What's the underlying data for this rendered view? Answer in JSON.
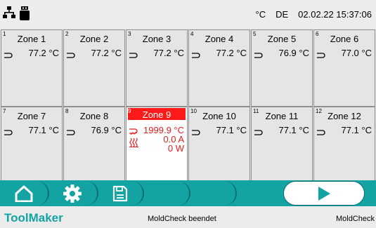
{
  "topbar": {
    "unit": "°C",
    "language": "DE",
    "date": "02.02.22",
    "time": "15:37:06"
  },
  "zones": [
    {
      "num": "1",
      "title": "Zone 1",
      "temp": "77.2 °C"
    },
    {
      "num": "2",
      "title": "Zone 2",
      "temp": "77.2 °C"
    },
    {
      "num": "3",
      "title": "Zone 3",
      "temp": "77.2 °C"
    },
    {
      "num": "4",
      "title": "Zone 4",
      "temp": "77.2 °C"
    },
    {
      "num": "5",
      "title": "Zone 5",
      "temp": "76.9 °C"
    },
    {
      "num": "6",
      "title": "Zone 6",
      "temp": "77.0 °C"
    },
    {
      "num": "7",
      "title": "Zone 7",
      "temp": "77.1 °C"
    },
    {
      "num": "8",
      "title": "Zone 8",
      "temp": "76.9 °C"
    },
    {
      "num": "9",
      "title": "Zone 9",
      "temp": "1999.9 °C",
      "current": "0.0 A",
      "power": "0 W",
      "alarm": true
    },
    {
      "num": "10",
      "title": "Zone 10",
      "temp": "77.1 °C"
    },
    {
      "num": "11",
      "title": "Zone 11",
      "temp": "77.1 °C"
    },
    {
      "num": "12",
      "title": "Zone 12",
      "temp": "77.1 °C"
    }
  ],
  "nav": {
    "icons": [
      "home-icon",
      "gear-icon",
      "save-icon",
      "play-icon"
    ]
  },
  "footer": {
    "brand": "ToolMaker",
    "message": "MoldCheck beendet",
    "right": "MoldCheck"
  },
  "colors": {
    "accent": "#13a3a3",
    "alarm": "#ff1a1a",
    "alarm_text": "#e51b1b",
    "panel": "#e5e5e5"
  }
}
